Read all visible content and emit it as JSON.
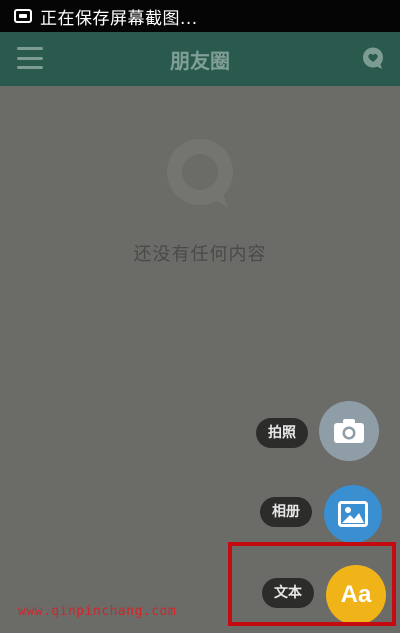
{
  "status_bar": {
    "text": "正在保存屏幕截图..."
  },
  "app_bar": {
    "title": "朋友圈"
  },
  "empty_state": {
    "message": "还没有任何内容"
  },
  "fab_menu": {
    "camera_label": "拍照",
    "album_label": "相册",
    "text_label": "文本",
    "text_button_glyph": "Aa"
  },
  "watermark": {
    "text": "www.qinpinchang.com"
  },
  "colors": {
    "app_bar": "#2a5a4e",
    "camera_button": "#8f9da6",
    "album_button": "#3a8fd0",
    "text_button": "#f0b419",
    "highlight": "#c40b12"
  }
}
